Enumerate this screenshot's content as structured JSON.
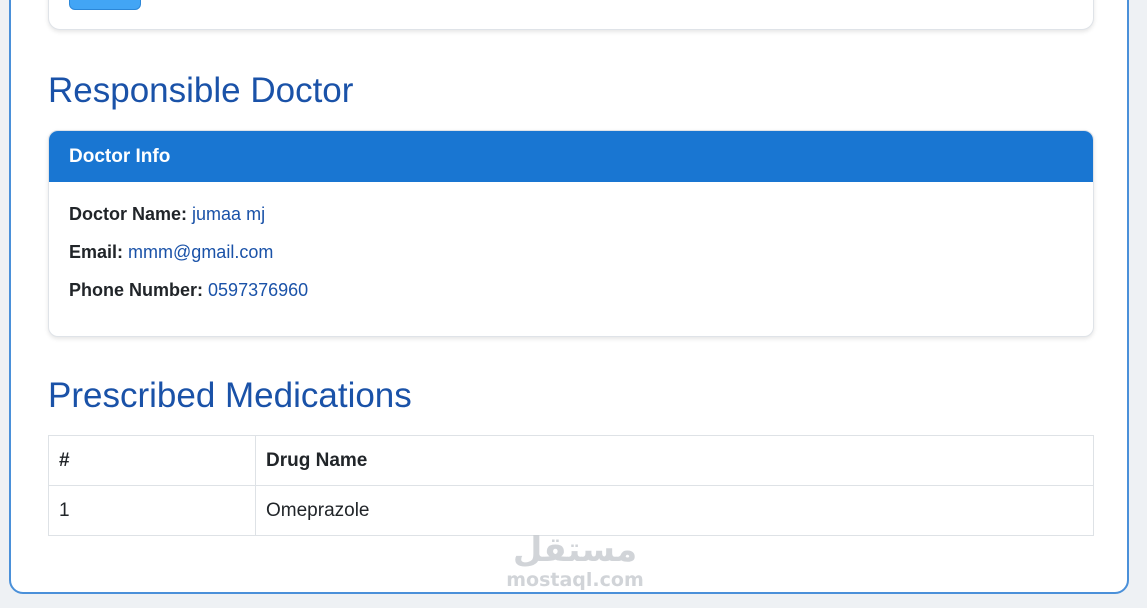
{
  "responsible_doctor": {
    "section_title": "Responsible Doctor",
    "card_header": "Doctor Info",
    "fields": [
      {
        "label": "Doctor Name:",
        "value": "jumaa mj"
      },
      {
        "label": "Email:",
        "value": "mmm@gmail.com"
      },
      {
        "label": "Phone Number:",
        "value": "0597376960"
      }
    ]
  },
  "medications": {
    "section_title": "Prescribed Medications",
    "columns": [
      "#",
      "Drug Name"
    ],
    "rows": [
      [
        "1",
        "Omeprazole"
      ]
    ]
  },
  "watermark": {
    "arabic": "مستقل",
    "latin": "mostaql.com"
  },
  "colors": {
    "accent": "#1976d2",
    "title": "#1a52a8",
    "frame_border": "#4a90d9"
  }
}
